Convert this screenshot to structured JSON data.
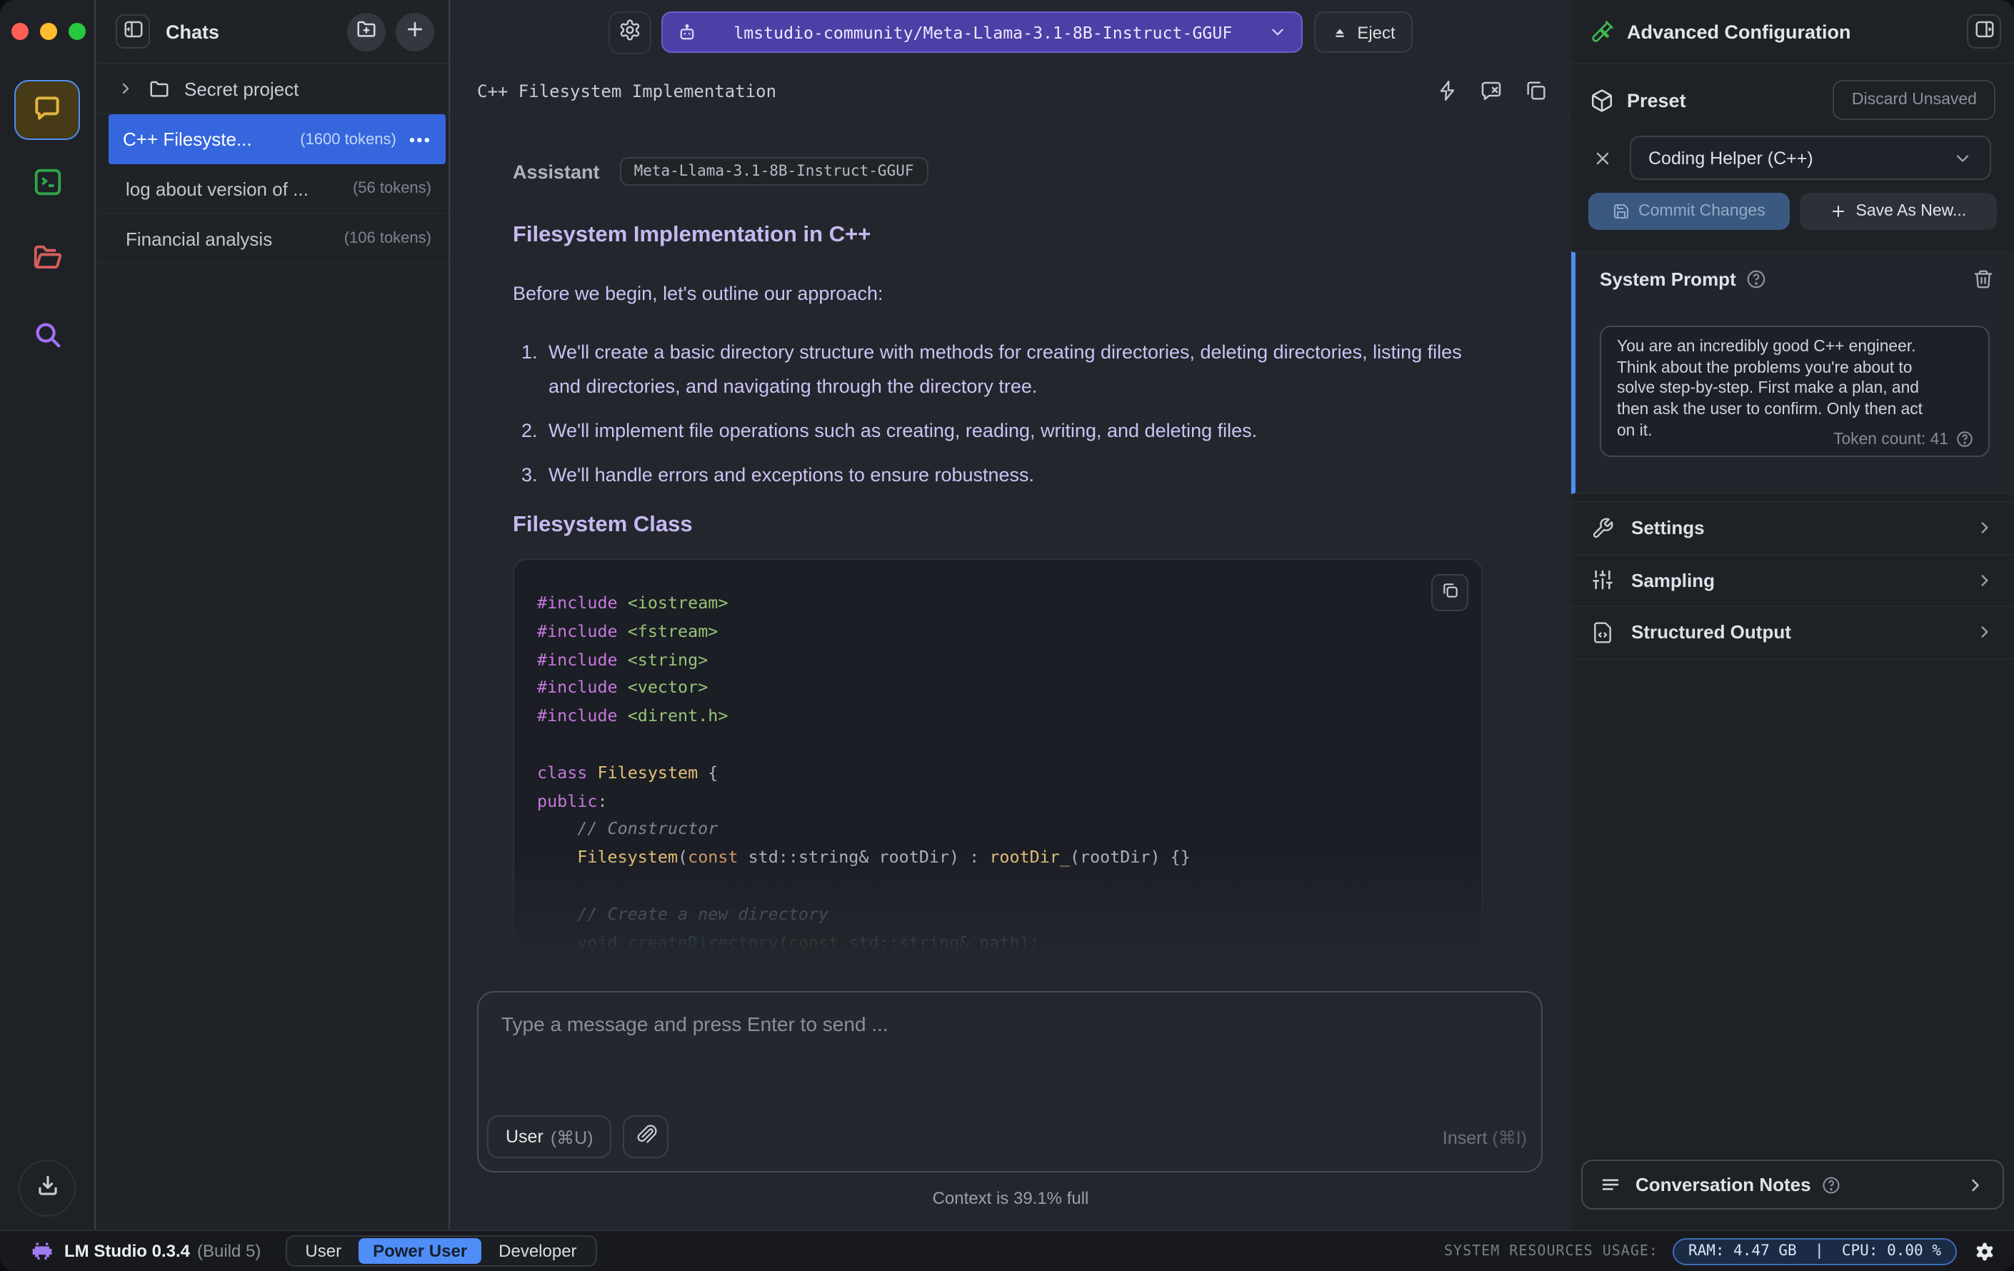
{
  "colors": {
    "accent_blue": "#4f8ef7",
    "selection_blue": "#3566dd",
    "model_pill": "#4c3fa5",
    "lavender": "#cbc2f3",
    "lavender_bold": "#c5b9f2",
    "code_keyword": "#c678dd",
    "code_string": "#98c379",
    "code_type": "#e5c07b",
    "code_const": "#d19a66",
    "code_comment": "#7d8590",
    "code_function": "#61afef",
    "rail_chat_yellow": "#e3b341",
    "rail_terminal_green": "#2ea649",
    "rail_folder_red": "#d65f5b",
    "rail_search_purple": "#a371f7",
    "traffic_red": "#ff5f57",
    "traffic_yellow": "#febc2e",
    "traffic_green": "#28c840"
  },
  "sidebar": {
    "title": "Chats",
    "folder_row": {
      "name": "Secret project"
    },
    "chats": [
      {
        "title": "C++ Filesyste...",
        "tokens": "(1600 tokens)",
        "menu": "•••"
      },
      {
        "title": "log about version of ...",
        "tokens": "(56 tokens)"
      },
      {
        "title": "Financial analysis",
        "tokens": "(106 tokens)"
      }
    ]
  },
  "topbar": {
    "model": "lmstudio-community/Meta-Llama-3.1-8B-Instruct-GGUF",
    "eject_label": "Eject"
  },
  "chat": {
    "title": "C++ Filesystem Implementation",
    "sender": "Assistant",
    "model_badge": "Meta-Llama-3.1-8B-Instruct-GGUF",
    "heading": "Filesystem Implementation in C++",
    "intro": "Before we begin, let's outline our approach:",
    "steps": [
      "We'll create a basic directory structure with methods for creating directories, deleting directories, listing files and directories, and navigating through the directory tree.",
      "We'll implement file operations such as creating, reading, writing, and deleting files.",
      "We'll handle errors and exceptions to ensure robustness."
    ],
    "subheading": "Filesystem Class",
    "code": {
      "lines": [
        [
          {
            "c": "pp",
            "t": "#include "
          },
          {
            "c": "str",
            "t": "<iostream>"
          }
        ],
        [
          {
            "c": "pp",
            "t": "#include "
          },
          {
            "c": "str",
            "t": "<fstream>"
          }
        ],
        [
          {
            "c": "pp",
            "t": "#include "
          },
          {
            "c": "str",
            "t": "<string>"
          }
        ],
        [
          {
            "c": "pp",
            "t": "#include "
          },
          {
            "c": "str",
            "t": "<vector>"
          }
        ],
        [
          {
            "c": "pp",
            "t": "#include "
          },
          {
            "c": "str",
            "t": "<dirent.h>"
          }
        ],
        [],
        [
          {
            "c": "kw",
            "t": "class "
          },
          {
            "c": "ty",
            "t": "Filesystem"
          },
          {
            "c": "pl",
            "t": " {"
          }
        ],
        [
          {
            "c": "kw",
            "t": "public"
          },
          {
            "c": "pl",
            "t": ":"
          }
        ],
        [
          {
            "c": "cm",
            "t": "    // Constructor"
          }
        ],
        [
          {
            "c": "ty",
            "t": "    Filesystem"
          },
          {
            "c": "pl",
            "t": "("
          },
          {
            "c": "kw2",
            "t": "const"
          },
          {
            "c": "pl",
            "t": " std::string& rootDir) : "
          },
          {
            "c": "ty",
            "t": "rootDir_"
          },
          {
            "c": "pl",
            "t": "(rootDir) {}"
          }
        ],
        [],
        [
          {
            "c": "cm",
            "t": "    // Create a new directory"
          }
        ],
        [
          {
            "c": "pl",
            "t": "    void "
          },
          {
            "c": "fn",
            "t": "createDirectory"
          },
          {
            "c": "pl",
            "t": "("
          },
          {
            "c": "kw2",
            "t": "const"
          },
          {
            "c": "pl",
            "t": " std::string& path);"
          }
        ]
      ]
    },
    "composer": {
      "placeholder": "Type a message and press Enter to send ...",
      "user_label": "User",
      "user_shortcut": "(⌘U)",
      "insert_label": "Insert",
      "insert_shortcut": "(⌘I)"
    },
    "context_note": "Context is 39.1% full"
  },
  "panel": {
    "title": "Advanced Configuration",
    "preset_label": "Preset",
    "discard_label": "Discard Unsaved",
    "preset_value": "Coding Helper (C++)",
    "commit_label": "Commit Changes",
    "save_new_label": "Save As New...",
    "system_prompt": {
      "label": "System Prompt",
      "text": "You are an incredibly good C++ engineer.\nThink about the problems you're about to\nsolve step-by-step. First make a plan, and\nthen ask the user to confirm. Only then act\non it.",
      "token_count": "Token count: 41"
    },
    "sections": [
      "Settings",
      "Sampling",
      "Structured Output"
    ],
    "notes_label": "Conversation Notes"
  },
  "statusbar": {
    "app": "LM Studio 0.3.4",
    "build": "(Build 5)",
    "modes": [
      "User",
      "Power User",
      "Developer"
    ],
    "active_mode": "Power User",
    "resources_label": "SYSTEM RESOURCES USAGE:",
    "resources_value": "RAM: 4.47 GB  |  CPU: 0.00 %"
  }
}
